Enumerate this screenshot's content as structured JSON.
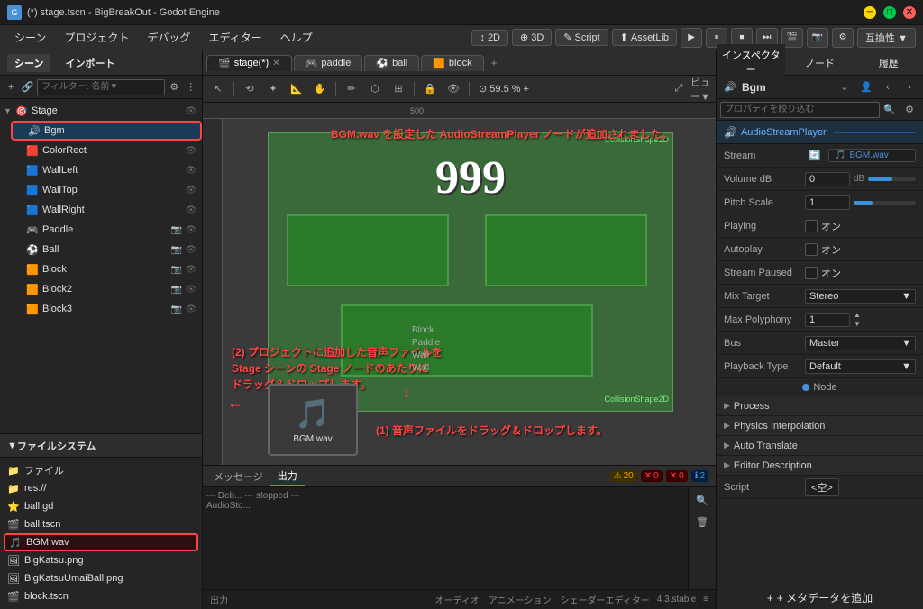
{
  "titlebar": {
    "title": "(*) stage.tscn - BigBreakOut - Godot Engine",
    "icon": "G"
  },
  "menubar": {
    "items": [
      "シーン",
      "プロジェクト",
      "デバッグ",
      "エディター",
      "ヘルプ"
    ],
    "toolbar_center": [
      "↕ 2D",
      "⊕ 3D",
      "✎ Script",
      "⬆ AssetLib"
    ],
    "toolbar_right": [
      "▶",
      "⏸",
      "⏹",
      "⏭",
      "📷",
      "📹",
      "🔧",
      "互換性 ▼"
    ]
  },
  "left_panel": {
    "tabs": [
      "シーン",
      "インポート"
    ],
    "scene_toolbar": {
      "add_icon": "+",
      "link_icon": "🔗",
      "filter_placeholder": "フィルター: 名前▼",
      "settings_icon": "⚙",
      "more_icon": "⋮"
    },
    "tree": [
      {
        "id": "stage",
        "label": "Stage",
        "icon": "🎯",
        "indent": 0,
        "arrow": "▼",
        "has_vis": true
      },
      {
        "id": "bgm",
        "label": "Bgm",
        "icon": "🔊",
        "indent": 1,
        "arrow": "",
        "has_vis": false,
        "selected": true
      },
      {
        "id": "colorrect",
        "label": "ColorRect",
        "icon": "🟥",
        "indent": 1,
        "arrow": "",
        "has_vis": true
      },
      {
        "id": "wallleft",
        "label": "WallLeft",
        "icon": "🟦",
        "indent": 1,
        "arrow": "",
        "has_vis": true
      },
      {
        "id": "walltop",
        "label": "WallTop",
        "icon": "🟦",
        "indent": 1,
        "arrow": "",
        "has_vis": true
      },
      {
        "id": "wallright",
        "label": "WallRight",
        "icon": "🟦",
        "indent": 1,
        "arrow": "",
        "has_vis": true
      },
      {
        "id": "paddle",
        "label": "Paddle",
        "icon": "🎮",
        "indent": 1,
        "arrow": "",
        "has_vis": true
      },
      {
        "id": "ball",
        "label": "Ball",
        "icon": "⚽",
        "indent": 1,
        "arrow": "",
        "has_vis": true
      },
      {
        "id": "block",
        "label": "Block",
        "icon": "🟧",
        "indent": 1,
        "arrow": "",
        "has_vis": true
      },
      {
        "id": "block2",
        "label": "Block2",
        "icon": "🟧",
        "indent": 1,
        "arrow": "",
        "has_vis": true
      },
      {
        "id": "block3",
        "label": "Block3",
        "icon": "🟧",
        "indent": 1,
        "arrow": "",
        "has_vis": true
      }
    ],
    "filesystem": {
      "title": "ファイルシステム",
      "items": [
        {
          "id": "files",
          "label": "ファイル",
          "icon": "📁"
        },
        {
          "id": "res",
          "label": "res://",
          "icon": "📁"
        },
        {
          "id": "ball_gd",
          "label": "ball.gd",
          "icon": "📜"
        },
        {
          "id": "ball_tscn",
          "label": "ball.tscn",
          "icon": "🎬"
        },
        {
          "id": "bgm_wav",
          "label": "BGM.wav",
          "icon": "🎵",
          "selected": true
        },
        {
          "id": "bigkatsu_png",
          "label": "BigKatsu.png",
          "icon": "🖼"
        },
        {
          "id": "bigkatsuumai_png",
          "label": "BigKatsuUmaiBall.png",
          "icon": "🖼"
        },
        {
          "id": "block_tscn",
          "label": "block.tscn",
          "icon": "🎬"
        }
      ]
    }
  },
  "center_panel": {
    "tabs": [
      {
        "id": "stage",
        "label": "stage(*)",
        "active": true,
        "closeable": true
      },
      {
        "id": "paddle",
        "label": "paddle",
        "active": false,
        "closeable": false
      },
      {
        "id": "ball",
        "label": "ball",
        "active": false,
        "closeable": false
      },
      {
        "id": "block",
        "label": "block",
        "active": false,
        "closeable": false
      }
    ],
    "tab_add_label": "+",
    "viewport_toolbar": {
      "tools": [
        "↖",
        "⟲",
        "✦",
        "📐",
        "✋",
        "✏",
        "⬡",
        "⊞",
        "🔒",
        "👁",
        "ビュー▼"
      ]
    },
    "zoom": "59.5 %",
    "canvas_ruler_label": "500",
    "annotations": {
      "main_text": "BGM.wav を設定した AudioStreamPlayer ノードが追加されました。",
      "text1": "(2) プロジェクトに追加した音声ファイルを\nStage シーンの Stage ノードのあたりに\nドラッグ＆ドロップします。",
      "text2": "(1) 音声ファイルをドラッグ＆ドロップします。"
    },
    "canvas_labels": {
      "collision1": "CollisionShape2D",
      "collision2": "CollisionShape2D",
      "number": "999"
    },
    "media_popup": {
      "label": "BGM.wav"
    }
  },
  "bottom_panel": {
    "tabs": [
      "メッセージ",
      "出力"
    ],
    "active_tab": "出力",
    "output_lines": [
      "--- Deb... --- sto stopped ---",
      "AudioSto..."
    ],
    "badges": {
      "warning": "20",
      "error1": "0",
      "error2": "0",
      "info": "2"
    }
  },
  "right_panel": {
    "tabs": [
      "インスペクター",
      "ノード",
      "履歴"
    ],
    "active_tab": "インスペクター",
    "node_name": "Bgm",
    "node_type": "AudioStreamPlayer",
    "filter_placeholder": "プロパティを絞り込む",
    "component_label": "AudioStreamPlayer",
    "properties": [
      {
        "id": "stream",
        "label": "Stream",
        "value_type": "file",
        "value": "BGM.wav",
        "icon": "🎵"
      },
      {
        "id": "volume_db",
        "label": "Volume dB",
        "value_type": "number_slider",
        "value": "0",
        "unit": "dB"
      },
      {
        "id": "pitch_scale",
        "label": "Pitch Scale",
        "value_type": "number",
        "value": "1"
      },
      {
        "id": "playing",
        "label": "Playing",
        "value_type": "checkbox_label",
        "checked": false,
        "label_val": "オン"
      },
      {
        "id": "autoplay",
        "label": "Autoplay",
        "value_type": "checkbox_label",
        "checked": false,
        "label_val": "オン"
      },
      {
        "id": "stream_paused",
        "label": "Stream Paused",
        "value_type": "checkbox_label",
        "checked": false,
        "label_val": "オン"
      },
      {
        "id": "mix_target",
        "label": "Mix Target",
        "value_type": "select",
        "value": "Stereo"
      },
      {
        "id": "max_polyphony",
        "label": "Max Polyphony",
        "value_type": "number_spin",
        "value": "1"
      },
      {
        "id": "bus",
        "label": "Bus",
        "value_type": "select",
        "value": "Master"
      },
      {
        "id": "playback_type",
        "label": "Playback Type",
        "value_type": "select",
        "value": "Default"
      }
    ],
    "sections": [
      {
        "id": "process",
        "label": "Process"
      },
      {
        "id": "physics_interpolation",
        "label": "Physics Interpolation"
      },
      {
        "id": "auto_translate",
        "label": "Auto Translate"
      },
      {
        "id": "editor_description",
        "label": "Editor Description"
      }
    ],
    "node_section_label": "Node",
    "script_label": "Script",
    "script_value": "<空>",
    "add_meta_label": "+ メタデータを追加"
  }
}
